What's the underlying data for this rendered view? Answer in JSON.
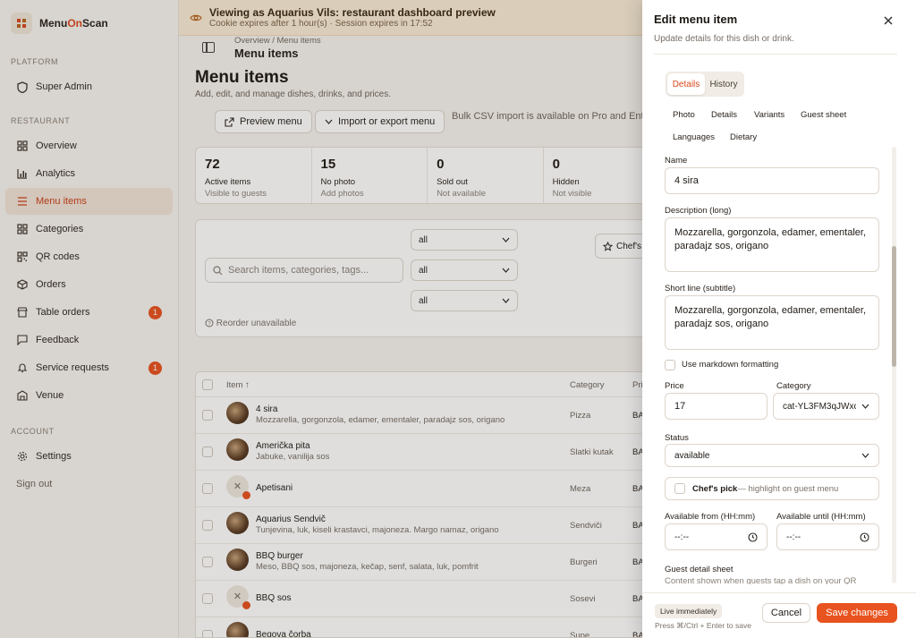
{
  "brand": {
    "name_part1": "Menu",
    "name_part2": "On",
    "name_part3": "Scan"
  },
  "sidebar": {
    "platform_label": "PLATFORM",
    "platform_items": [
      {
        "label": "Super Admin",
        "icon": "shield-icon"
      }
    ],
    "restaurant_label": "RESTAURANT",
    "restaurant_items": [
      {
        "label": "Overview",
        "icon": "grid-icon"
      },
      {
        "label": "Analytics",
        "icon": "bar-chart-icon"
      },
      {
        "label": "Menu items",
        "icon": "list-icon",
        "active": true
      },
      {
        "label": "Categories",
        "icon": "grid-icon"
      },
      {
        "label": "QR codes",
        "icon": "qr-icon"
      },
      {
        "label": "Orders",
        "icon": "box-icon"
      },
      {
        "label": "Table orders",
        "icon": "store-icon",
        "badge": "1"
      },
      {
        "label": "Feedback",
        "icon": "message-icon"
      },
      {
        "label": "Service requests",
        "icon": "bell-icon",
        "badge": "1"
      },
      {
        "label": "Venue",
        "icon": "building-icon"
      }
    ],
    "account_label": "ACCOUNT",
    "account_items": [
      {
        "label": "Settings",
        "icon": "gear-icon"
      }
    ],
    "sign_out": "Sign out"
  },
  "banner": {
    "title": "Viewing as Aquarius Vils: restaurant dashboard preview",
    "subtitle": "Cookie expires after 1 hour(s) · Session expires in 17:52"
  },
  "main": {
    "breadcrumb": "Overview / Menu items",
    "header_title": "Menu items",
    "page_title": "Menu items",
    "page_subtitle": "Add, edit, and manage dishes, drinks, and prices.",
    "preview_button": "Preview menu",
    "import_button": "Import or export menu",
    "csv_note": "Bulk CSV import is available on Pro and Ent",
    "stats": [
      {
        "num": "72",
        "label": "Active items",
        "hint": "Visible to guests"
      },
      {
        "num": "15",
        "label": "No photo",
        "hint": "Add photos"
      },
      {
        "num": "0",
        "label": "Sold out",
        "hint": "Not available"
      },
      {
        "num": "0",
        "label": "Hidden",
        "hint": "Not visible"
      }
    ],
    "search_placeholder": "Search items, categories, tags...",
    "filter_values": [
      "all",
      "all",
      "all"
    ],
    "chefs_button": "Chef's p",
    "reorder_note": "Reorder unavailable",
    "table": {
      "headers": {
        "item": "Item ↑",
        "category": "Category",
        "price": "Pri"
      },
      "rows": [
        {
          "name": "4 sira",
          "desc": "Mozzarella, gorgonzola, edamer, ementaler, paradajz sos, origano",
          "category": "Pizza",
          "price": "BA",
          "photo": true
        },
        {
          "name": "Američka pita",
          "desc": "Jabuke, vanilija sos",
          "category": "Slatki kutak",
          "price": "BA",
          "photo": true
        },
        {
          "name": "Apetisani",
          "desc": "",
          "category": "Meza",
          "price": "BA",
          "photo": false
        },
        {
          "name": "Aquarius Sendvič",
          "desc": "Tunjevina, luk, kiseli krastavci, majoneza. Margo namaz, origano",
          "category": "Sendviči",
          "price": "BA",
          "photo": true
        },
        {
          "name": "BBQ burger",
          "desc": "Meso, BBQ sos, majoneza, kečap, senf, salata, luk, pomfrit",
          "category": "Burgeri",
          "price": "BA",
          "photo": true
        },
        {
          "name": "BBQ sos",
          "desc": "",
          "category": "Sosevi",
          "price": "BA",
          "photo": false
        },
        {
          "name": "Begova čorba",
          "desc": "",
          "category": "Supe",
          "price": "BA",
          "photo": true
        }
      ]
    }
  },
  "drawer": {
    "title": "Edit menu item",
    "subtitle": "Update details for this dish or drink.",
    "segments": [
      "Details",
      "History"
    ],
    "subtabs": [
      "Photo",
      "Details",
      "Variants",
      "Guest sheet",
      "Languages",
      "Dietary"
    ],
    "name_label": "Name",
    "name_value": "4 sira",
    "desc_label": "Description (long)",
    "desc_value": "Mozzarella, gorgonzola, edamer, ementaler, paradajz sos, origano",
    "short_label": "Short line (subtitle)",
    "short_value": "Mozzarella, gorgonzola, edamer, ementaler, paradajz sos, origano",
    "markdown_label": "Use markdown formatting",
    "price_label": "Price",
    "price_value": "17",
    "category_label": "Category",
    "category_value": "cat-YL3FM3qJWxc",
    "status_label": "Status",
    "status_value": "available",
    "chefs_pick_label": "Chef's pick",
    "chefs_pick_hint": " — highlight on guest menu",
    "from_label": "Available from (HH:mm)",
    "until_label": "Available until (HH:mm)",
    "time_placeholder": "--:--",
    "guest_sheet_label": "Guest detail sheet",
    "guest_sheet_hint": "Content shown when guests tap a dish on your QR",
    "live_pill": "Live immediately",
    "shortcut_hint": "Press ⌘/Ctrl + Enter to save",
    "cancel": "Cancel",
    "save": "Save changes"
  },
  "colors": {
    "accent": "#e8531f",
    "banner": "#faecd6",
    "active_nav": "#f1e3d7"
  }
}
